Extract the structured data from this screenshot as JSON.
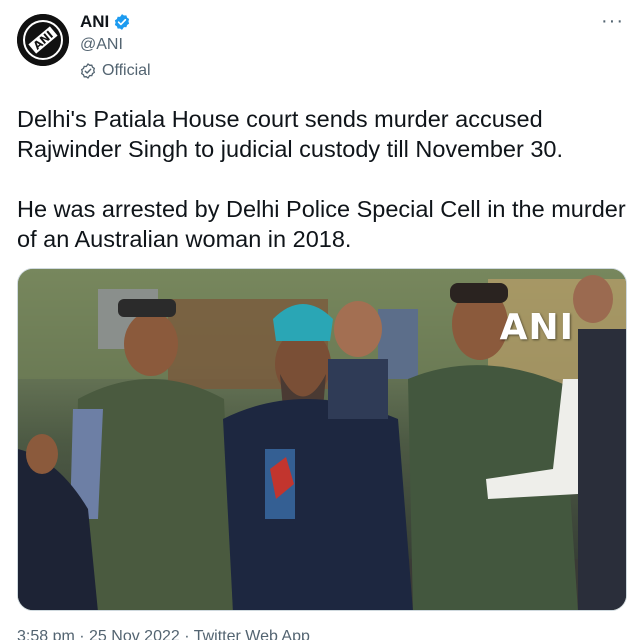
{
  "account": {
    "display_name": "ANI",
    "handle": "@ANI",
    "label": "Official",
    "avatar_icon": "ani-logo-icon",
    "verified_icon": "verified-badge-icon",
    "label_icon": "official-label-icon"
  },
  "menu": {
    "more_label": "···",
    "more_icon": "more-options-icon"
  },
  "tweet": {
    "paragraph_1": "Delhi's Patiala House court sends murder accused Rajwinder Singh to judicial custody till November 30.",
    "paragraph_2": "He was arrested by Delhi Police Special Cell in the murder of an Australian woman in 2018."
  },
  "media": {
    "watermark": "ANI",
    "avatar_text": "ANI"
  },
  "footer": {
    "meta": "3:58 pm · 25 Nov 2022 · Twitter Web App"
  },
  "colors": {
    "text": "#0f1419",
    "secondary": "#536471",
    "verified_blue": "#1d9bf0"
  }
}
